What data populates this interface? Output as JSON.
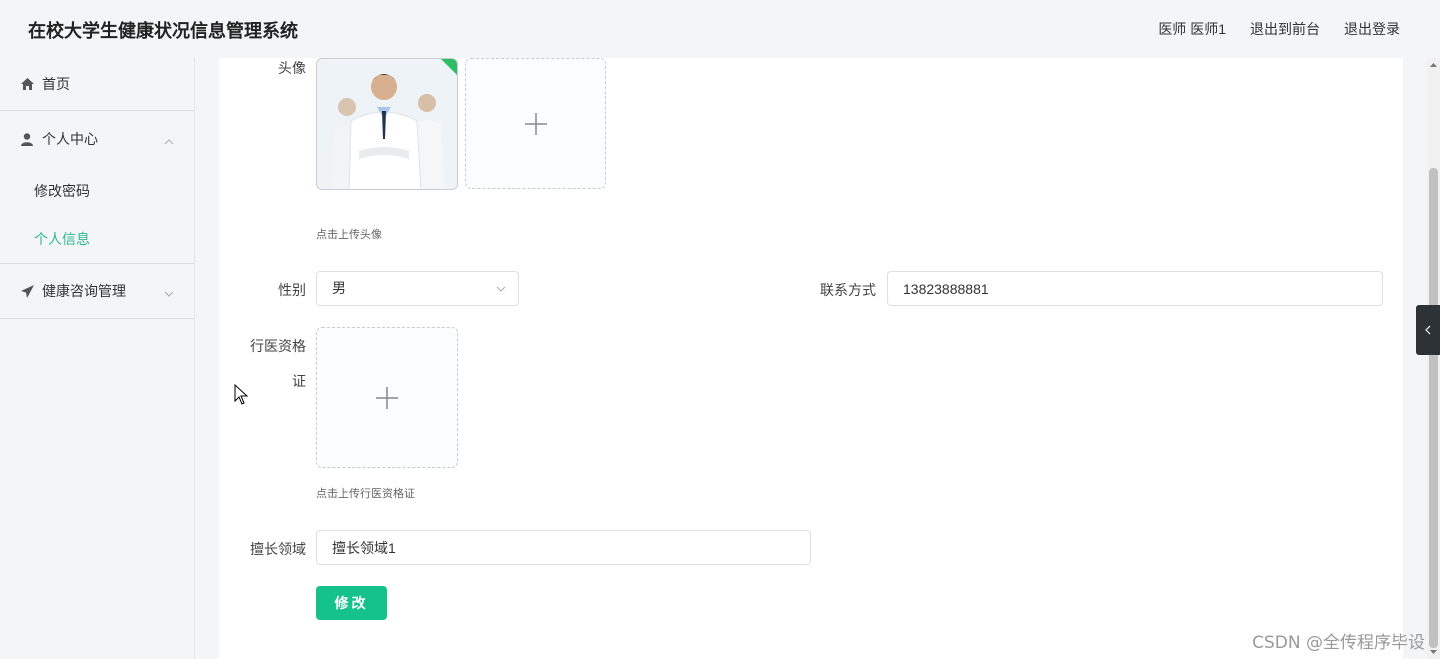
{
  "header": {
    "title": "在校大学生健康状况信息管理系统",
    "user_label": "医师 医师1",
    "back_to_front": "退出到前台",
    "logout": "退出登录"
  },
  "sidebar": {
    "items": [
      {
        "label": "首页",
        "icon": "home-icon"
      },
      {
        "label": "个人中心",
        "icon": "user-icon",
        "expanded": true
      },
      {
        "label": "修改密码"
      },
      {
        "label": "个人信息",
        "active": true
      },
      {
        "label": "健康咨询管理",
        "icon": "send-icon",
        "expanded": false
      }
    ]
  },
  "form": {
    "avatar_label": "头像",
    "avatar_tip": "点击上传头像",
    "gender_label": "性别",
    "gender_value": "男",
    "contact_label": "联系方式",
    "contact_value": "13823888881",
    "license_label_1": "行医资格",
    "license_label_2": "证",
    "license_tip": "点击上传行医资格证",
    "specialty_label": "擅长领域",
    "specialty_value": "擅长领域1",
    "submit_label": "修改"
  },
  "watermark": "CSDN @全传程序毕设",
  "colors": {
    "accent": "#15c28a",
    "active_menu": "#2fb893",
    "background": "#f4f5f7"
  }
}
